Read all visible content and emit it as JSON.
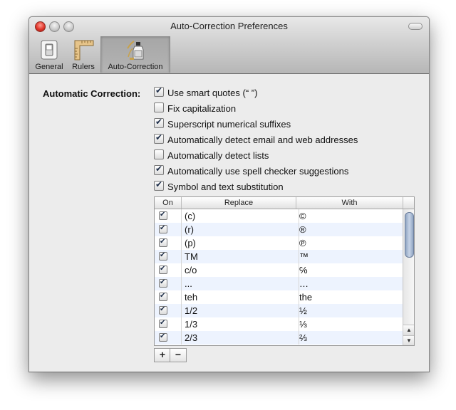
{
  "window": {
    "title": "Auto-Correction Preferences"
  },
  "toolbar": {
    "items": [
      {
        "label": "General",
        "icon": "general-switch-icon"
      },
      {
        "label": "Rulers",
        "icon": "ruler-icon"
      },
      {
        "label": "Auto-Correction",
        "icon": "spray-bottle-icon",
        "selected": true
      }
    ]
  },
  "main": {
    "section_label": "Automatic Correction:",
    "options": [
      {
        "label": "Use smart quotes (“ ”)",
        "checked": true
      },
      {
        "label": "Fix capitalization",
        "checked": false
      },
      {
        "label": "Superscript numerical suffixes",
        "checked": true
      },
      {
        "label": "Automatically detect email and web addresses",
        "checked": true
      },
      {
        "label": "Automatically detect lists",
        "checked": false
      },
      {
        "label": "Automatically use spell checker suggestions",
        "checked": true
      },
      {
        "label": "Symbol and text substitution",
        "checked": true
      }
    ],
    "table": {
      "headers": {
        "on": "On",
        "replace": "Replace",
        "with": "With"
      },
      "rows": [
        {
          "on": true,
          "replace": "(c)",
          "with": "©"
        },
        {
          "on": true,
          "replace": "(r)",
          "with": "®"
        },
        {
          "on": true,
          "replace": "(p)",
          "with": "℗"
        },
        {
          "on": true,
          "replace": "TM",
          "with": "™"
        },
        {
          "on": true,
          "replace": "c/o",
          "with": "℅"
        },
        {
          "on": true,
          "replace": "...",
          "with": "…"
        },
        {
          "on": true,
          "replace": "teh",
          "with": "the"
        },
        {
          "on": true,
          "replace": "1/2",
          "with": "½"
        },
        {
          "on": true,
          "replace": "1/3",
          "with": "⅓"
        },
        {
          "on": true,
          "replace": "2/3",
          "with": "⅔"
        }
      ]
    },
    "buttons": {
      "add": "+",
      "remove": "−"
    }
  }
}
